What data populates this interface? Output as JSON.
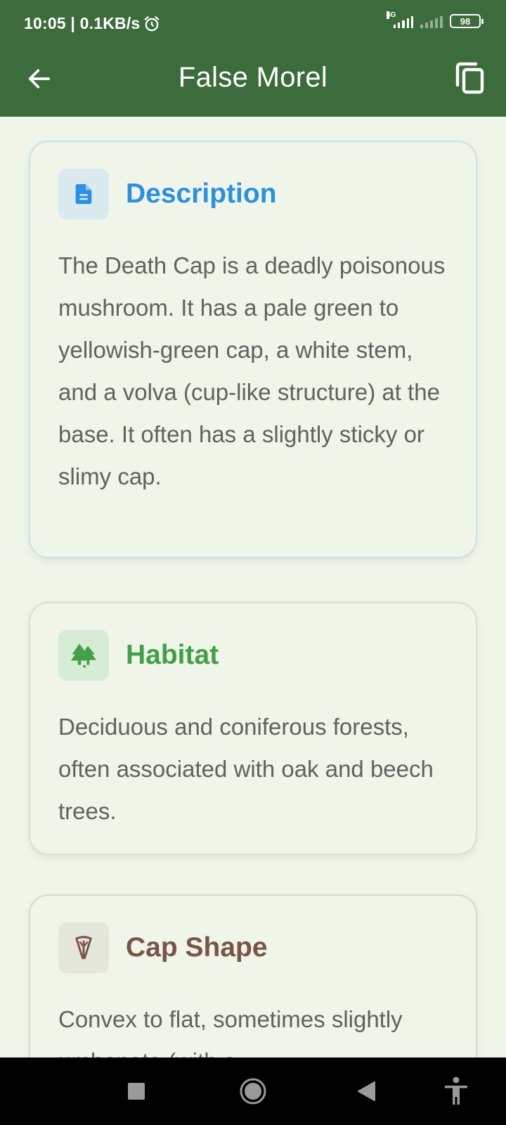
{
  "status_bar": {
    "time_speed": "10:05 | 0.1KB/s",
    "network_type": "4G",
    "battery": "98"
  },
  "app_bar": {
    "title": "False Morel",
    "back_icon": "arrow-back-icon",
    "copy_icon": "copy-icon"
  },
  "cards": {
    "description": {
      "title": "Description",
      "icon": "document-icon",
      "body": "The Death Cap is a deadly poisonous mushroom.  It has a pale green to yellowish-green cap, a white stem, and a volva (cup-like structure) at the base. It often has a slightly sticky or slimy cap.",
      "color": "#2d8fe0"
    },
    "habitat": {
      "title": "Habitat",
      "icon": "forest-icon",
      "body": "Deciduous and coniferous forests, often associated with oak and beech trees.",
      "color": "#43a047"
    },
    "cap_shape": {
      "title": "Cap Shape",
      "icon": "umbrella-icon",
      "body": "Convex to flat, sometimes slightly umbonate (with a",
      "color": "#795548"
    }
  },
  "nav_bar": {
    "recents_icon": "square-icon",
    "home_icon": "circle-icon",
    "back_icon": "triangle-back-icon",
    "accessibility_icon": "accessibility-icon"
  },
  "colors": {
    "primary": "#3c6b3c",
    "background": "#eff5e8"
  }
}
